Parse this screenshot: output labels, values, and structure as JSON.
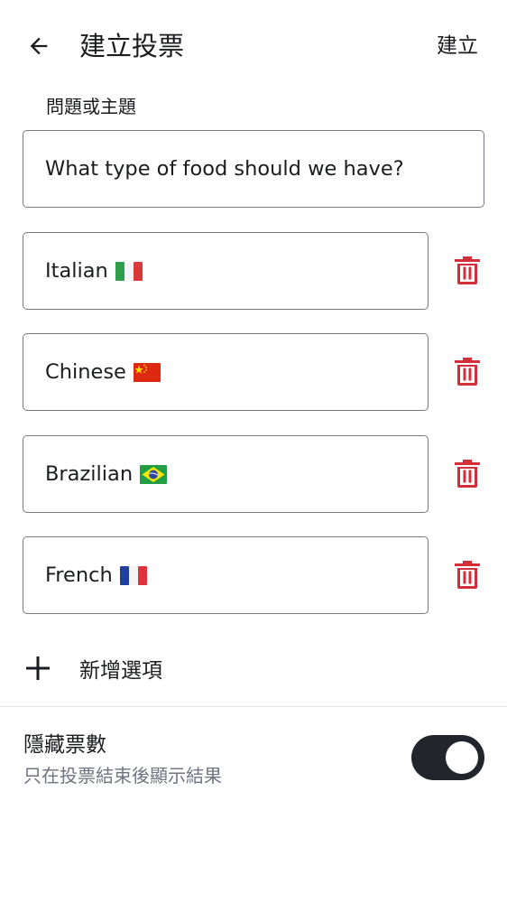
{
  "header": {
    "title": "建立投票",
    "create_label": "建立"
  },
  "question": {
    "label": "問題或主題",
    "value": "What type of food should we have?"
  },
  "options": [
    {
      "text": "Italian",
      "flag": "italy-flag"
    },
    {
      "text": "Chinese",
      "flag": "china-flag"
    },
    {
      "text": "Brazilian",
      "flag": "brazil-flag"
    },
    {
      "text": "French",
      "flag": "france-flag"
    }
  ],
  "add_option": {
    "label": "新增選項"
  },
  "hide_votes": {
    "title": "隱藏票數",
    "subtitle": "只在投票結束後顯示結果",
    "enabled": true
  },
  "colors": {
    "delete_red": "#d32f3a",
    "text": "#1b1c1f",
    "border": "#757a84",
    "subtitle": "#6e7480",
    "toggle_track": "#22252c"
  }
}
